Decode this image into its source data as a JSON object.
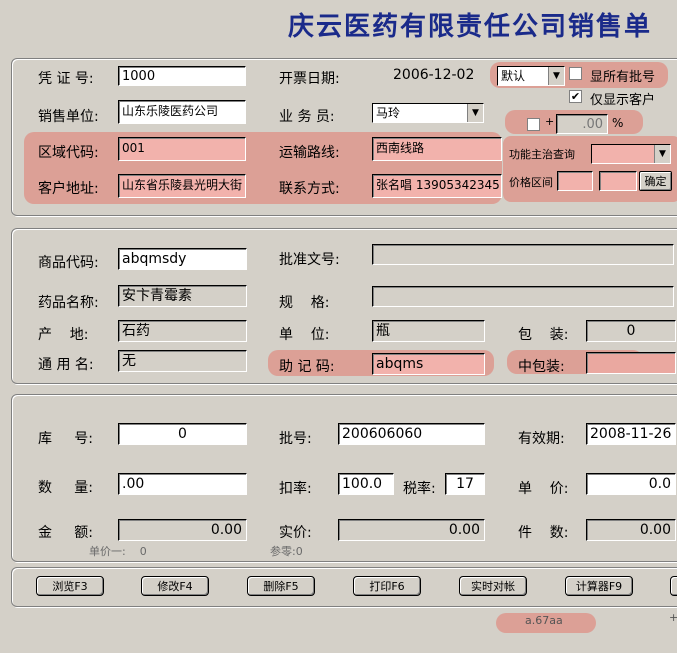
{
  "header": {
    "title": "庆云医药有限责任公司销售单"
  },
  "invoice": {
    "voucher_label": "凭 证 号:",
    "voucher_value": "1000",
    "date_label": "开票日期:",
    "date_value": "2006-12-02",
    "type_select": "默认",
    "show_all_batch_label": "显所有批号",
    "show_customer_label": "仅显示客户",
    "unit_label": "销售单位:",
    "unit_value": "山东乐陵医药公司",
    "salesman_label": "业 务 员:",
    "salesman_value": "马玲",
    "plus_sign": "+",
    "percent_value": ".00",
    "percent_sign": "%",
    "area_label": "区域代码:",
    "area_value": "001",
    "route_label": "运输路线:",
    "route_value": "西南线路",
    "function_query_label": "功能主治查询",
    "address_label": "客户地址:",
    "address_value": "山东省乐陵县光明大街",
    "contact_label": "联系方式:",
    "contact_value": "张名唱 13905342345",
    "price_range_label": "价格区间",
    "confirm_label": "确定"
  },
  "product": {
    "code_label": "商品代码:",
    "code_value": "abqmsdy",
    "approval_label": "批准文号:",
    "approval_value": "",
    "name_label": "药品名称:",
    "name_value": "安卞青霉素",
    "spec_label": "规    格:",
    "spec_value": "",
    "origin_label": "产    地:",
    "origin_value": "石药",
    "unit_label": "单    位:",
    "unit_value": "瓶",
    "pack_label": "包    装:",
    "pack_value": "0",
    "generic_label": "通 用 名:",
    "generic_value": "无",
    "mnemonic_label": "助 记 码:",
    "mnemonic_value": "abqms",
    "mid_pack_label": "中包装:",
    "mid_pack_value": ""
  },
  "stock": {
    "warehouse_label": "库     号:",
    "warehouse_value": "0",
    "batch_label": "批号:",
    "batch_value": "200606060",
    "expiry_label": "有效期:",
    "expiry_value": "2008-11-26",
    "qty_label": "数     量:",
    "qty_value": ".00",
    "discount_label": "扣率:",
    "discount_value": "100.0",
    "tax_label": "税率:",
    "tax_value": "17",
    "price_label": "单    价:",
    "price_value": "0.0",
    "amount_label": "金     额:",
    "amount_value": "0.00",
    "real_price_label": "实价:",
    "real_price_value": "0.00",
    "count_label": "件    数:",
    "count_value": "0.00",
    "unit_price1_note": "单价一:    0",
    "ref_note": "参零:0"
  },
  "toolbar": {
    "browse": "浏览F3",
    "edit": "修改F4",
    "delete": "删除F5",
    "print": "打印F6",
    "reconcile": "实时对帐",
    "calculator": "计算器F9"
  },
  "status": {
    "code": "a.67aa",
    "plus": "+"
  }
}
